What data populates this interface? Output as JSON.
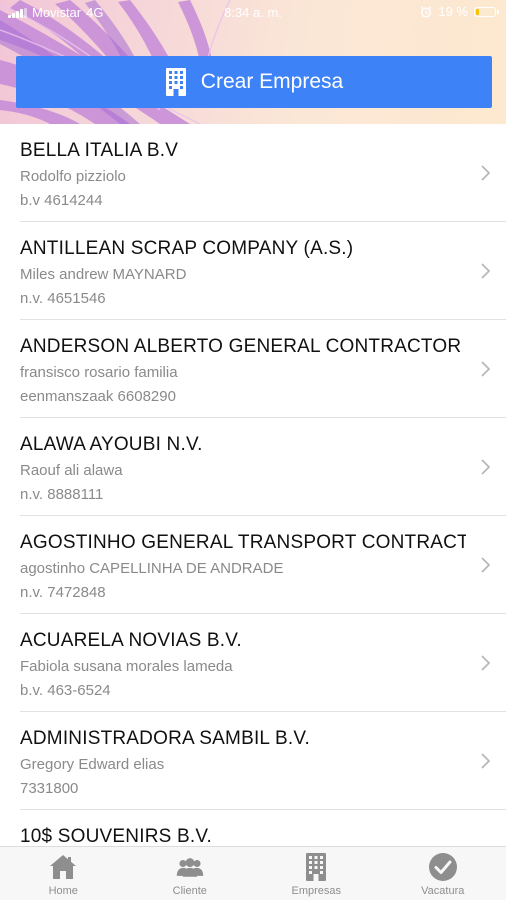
{
  "status_bar": {
    "carrier": "Movistar",
    "network": "4G",
    "time": "8:34 a. m.",
    "battery": "19 %",
    "battery_level": 0.19
  },
  "header": {
    "create_button_label": "Crear Empresa"
  },
  "companies": [
    {
      "name": "BELLA ITALIA B.V",
      "contact": "Rodolfo pizziolo",
      "registration": "b.v 4614244"
    },
    {
      "name": "ANTILLEAN SCRAP COMPANY (A.S.)",
      "contact": "Miles andrew MAYNARD",
      "registration": "n.v. 4651546"
    },
    {
      "name": "ANDERSON ALBERTO GENERAL CONTRACTOR",
      "contact": "fransisco rosario familia",
      "registration": "eenmanszaak 6608290"
    },
    {
      "name": "ALAWA AYOUBI N.V.",
      "contact": "Raouf ali alawa",
      "registration": "n.v. 8888111"
    },
    {
      "name": "AGOSTINHO GENERAL TRANSPORT CONTRACTOR",
      "contact": "agostinho CAPELLINHA DE ANDRADE",
      "registration": "n.v. 7472848"
    },
    {
      "name": "ACUARELA NOVIAS B.V.",
      "contact": "Fabiola susana morales lameda",
      "registration": "b.v. 463-6524"
    },
    {
      "name": "ADMINISTRADORA SAMBIL B.V.",
      "contact": "Gregory Edward elias",
      "registration": "7331800"
    },
    {
      "name": "10$ SOUVENIRS B.V.",
      "contact": "",
      "registration": ""
    }
  ],
  "tabbar": {
    "tabs": [
      {
        "label": "Home",
        "icon": "home-icon"
      },
      {
        "label": "Cliente",
        "icon": "clients-icon"
      },
      {
        "label": "Empresas",
        "icon": "building-icon"
      },
      {
        "label": "Vacatura",
        "icon": "checkmark-circle-icon"
      }
    ]
  },
  "colors": {
    "accent": "#3d82f6",
    "battery_low": "#f5c400",
    "tab_inactive": "#8e8e8e"
  }
}
